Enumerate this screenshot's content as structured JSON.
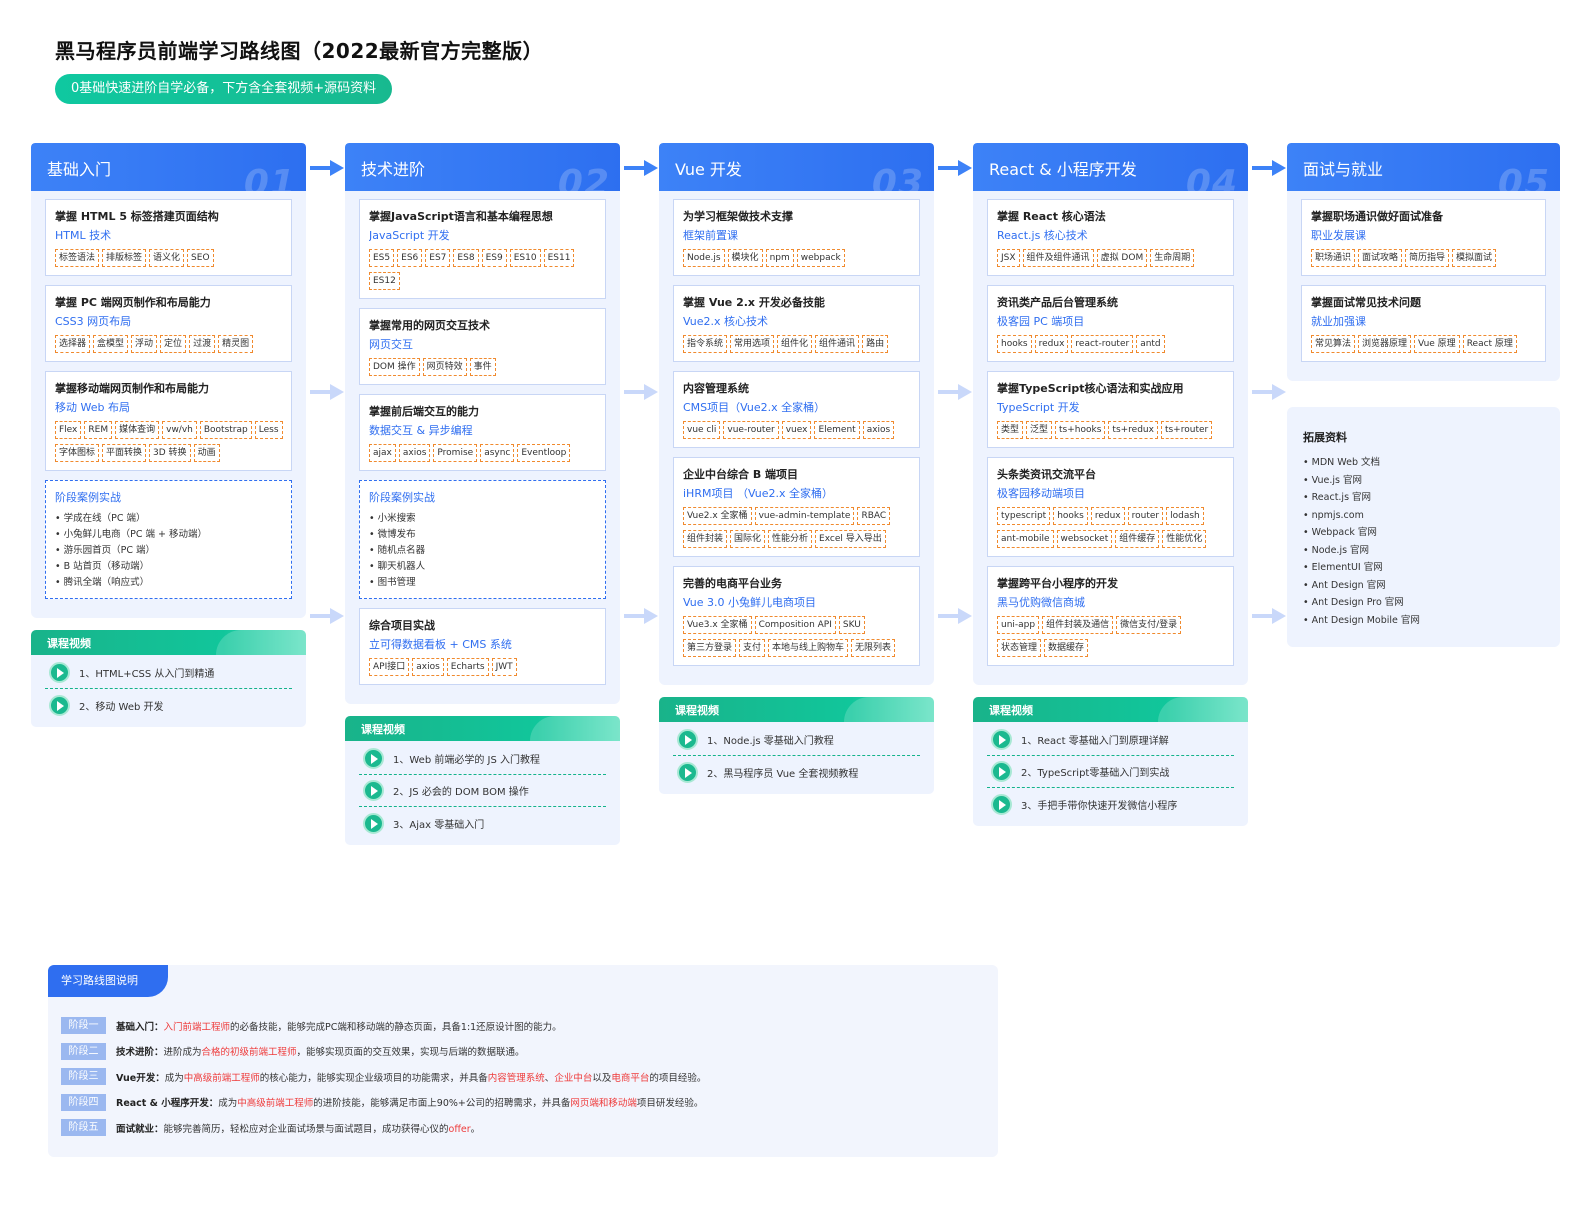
{
  "header": {
    "title": "黑马程序员前端学习路线图（2022最新官方完整版）",
    "subtitle": "0基础快速进阶自学必备，下方含全套视频+源码资料"
  },
  "columns": [
    {
      "label": "基础入门",
      "number": "01",
      "cards": [
        {
          "title": "掌握 HTML 5 标签搭建页面结构",
          "sub": "HTML 技术",
          "tags": [
            "标签语法",
            "排版标签",
            "语义化",
            "SEO"
          ]
        },
        {
          "title": "掌握 PC 端网页制作和布局能力",
          "sub": "CSS3 网页布局",
          "tags": [
            "选择器",
            "盒模型",
            "浮动",
            "定位",
            "过渡",
            "精灵图"
          ]
        },
        {
          "title": "掌握移动端网页制作和布局能力",
          "sub": "移动 Web 布局",
          "tags": [
            "Flex",
            "REM",
            "媒体查询",
            "vw/vh",
            "Bootstrap",
            "Less",
            "字体图标",
            "平面转换",
            "3D 转换",
            "动画"
          ]
        }
      ],
      "case": {
        "title": "阶段案例实战",
        "items": [
          "学成在线（PC 端）",
          "小兔鲜儿电商（PC 端 + 移动端）",
          "游乐园首页（PC 端）",
          "B 站首页（移动端）",
          "腾讯全端（响应式）"
        ]
      },
      "video": {
        "label": "课程视频",
        "items": [
          "1、HTML+CSS 从入门到精通",
          "2、移动 Web 开发"
        ]
      }
    },
    {
      "label": "技术进阶",
      "number": "02",
      "cards": [
        {
          "title": "掌握JavaScript语言和基本编程思想",
          "sub": "JavaScript 开发",
          "tags": [
            "ES5",
            "ES6",
            "ES7",
            "ES8",
            "ES9",
            "ES10",
            "ES11",
            "ES12"
          ]
        },
        {
          "title": "掌握常用的网页交互技术",
          "sub": "网页交互",
          "tags": [
            "DOM 操作",
            "网页特效",
            "事件"
          ]
        },
        {
          "title": "掌握前后端交互的能力",
          "sub": "数据交互 & 异步编程",
          "tags": [
            "ajax",
            "axios",
            "Promise",
            "async",
            "Eventloop"
          ]
        }
      ],
      "case": {
        "title": "阶段案例实战",
        "items": [
          "小米搜索",
          "微博发布",
          "随机点名器",
          "聊天机器人",
          "图书管理"
        ]
      },
      "cards_after": [
        {
          "title": "综合项目实战",
          "sub": "立可得数据看板 + CMS 系统",
          "tags": [
            "API接口",
            "axios",
            "Echarts",
            "JWT"
          ]
        }
      ],
      "video": {
        "label": "课程视频",
        "items": [
          "1、Web 前端必学的 JS 入门教程",
          "2、JS 必会的 DOM BOM 操作",
          "3、Ajax 零基础入门"
        ]
      }
    },
    {
      "label": "Vue 开发",
      "number": "03",
      "cards": [
        {
          "title": "为学习框架做技术支撑",
          "sub": "框架前置课",
          "tags": [
            "Node.js",
            "模块化",
            "npm",
            "webpack"
          ]
        },
        {
          "title": "掌握 Vue 2.x 开发必备技能",
          "sub": "Vue2.x 核心技术",
          "tags": [
            "指令系统",
            "常用选项",
            "组件化",
            "组件通讯",
            "路由"
          ]
        },
        {
          "title": "内容管理系统",
          "sub": "CMS项目（Vue2.x 全家桶）",
          "tags": [
            "vue cli",
            "vue-router",
            "vuex",
            "Element",
            "axios"
          ]
        },
        {
          "title": "企业中台综合 B 端项目",
          "sub": "iHRM项目 （Vue2.x 全家桶）",
          "tags": [
            "Vue2.x 全家桶",
            "vue-admin-template",
            "RBAC",
            "组件封装",
            "国际化",
            "性能分析",
            "Excel 导入导出"
          ]
        },
        {
          "title": "完善的电商平台业务",
          "sub": "Vue 3.0 小兔鲜儿电商项目",
          "tags": [
            "Vue3.x 全家桶",
            "Composition API",
            "SKU",
            "第三方登录",
            "支付",
            "本地与线上购物车",
            "无限列表"
          ]
        }
      ],
      "video": {
        "label": "课程视频",
        "items": [
          "1、Node.js 零基础入门教程",
          "2、黑马程序员 Vue 全套视频教程"
        ]
      }
    },
    {
      "label": "React & 小程序开发",
      "number": "04",
      "cards": [
        {
          "title": "掌握 React 核心语法",
          "sub": "React.js 核心技术",
          "tags": [
            "JSX",
            "组件及组件通讯",
            "虚拟 DOM",
            "生命周期"
          ]
        },
        {
          "title": "资讯类产品后台管理系统",
          "sub": "极客园 PC 端项目",
          "tags": [
            "hooks",
            "redux",
            "react-router",
            "antd"
          ]
        },
        {
          "title": "掌握TypeScript核心语法和实战应用",
          "sub": "TypeScript 开发",
          "tags": [
            "类型",
            "泛型",
            "ts+hooks",
            "ts+redux",
            "ts+router"
          ]
        },
        {
          "title": "头条类资讯交流平台",
          "sub": "极客园移动端项目",
          "tags": [
            "typescript",
            "hooks",
            "redux",
            "router",
            "lodash",
            "ant-mobile",
            "websocket",
            "组件缓存",
            "性能优化"
          ]
        },
        {
          "title": "掌握跨平台小程序的开发",
          "sub": "黑马优购微信商城",
          "tags": [
            "uni-app",
            "组件封装及通信",
            "微信支付/登录",
            "状态管理",
            "数据缓存"
          ]
        }
      ],
      "video": {
        "label": "课程视频",
        "items": [
          "1、React 零基础入门到原理详解",
          "2、TypeScript零基础入门到实战",
          "3、手把手带你快速开发微信小程序"
        ]
      }
    },
    {
      "label": "面试与就业",
      "number": "05",
      "cards": [
        {
          "title": "掌握职场通识做好面试准备",
          "sub": "职业发展课",
          "tags": [
            "职场通识",
            "面试攻略",
            "简历指导",
            "模拟面试"
          ]
        },
        {
          "title": "掌握面试常见技术问题",
          "sub": "就业加强课",
          "tags": [
            "常见算法",
            "浏览器原理",
            "Vue 原理",
            "React 原理"
          ]
        }
      ]
    }
  ],
  "resources": {
    "title": "拓展资料",
    "items": [
      "MDN Web 文档",
      "Vue.js 官网",
      "React.js 官网",
      "npmjs.com",
      "Webpack 官网",
      "Node.js 官网",
      "ElementUI 官网",
      "Ant Design 官网",
      "Ant Design Pro 官网",
      "Ant Design Mobile 官网"
    ]
  },
  "legend": {
    "title": "学习路线图说明",
    "rows": [
      {
        "badge": "阶段一",
        "name": "基础入门：",
        "parts": [
          [
            "入门前端工程师",
            true
          ],
          [
            "的必备技能，能够完成PC端和移动端的静态页面，具备1:1还原设计图的能力。",
            false
          ]
        ]
      },
      {
        "badge": "阶段二",
        "name": "技术进阶：",
        "parts": [
          [
            "进阶成为",
            false
          ],
          [
            "合格的初级前端工程师",
            true
          ],
          [
            "，能够实现页面的交互效果，实现与后端的数据联通。",
            false
          ]
        ]
      },
      {
        "badge": "阶段三",
        "name": "Vue开发：",
        "parts": [
          [
            "成为",
            false
          ],
          [
            "中高级前端工程师",
            true
          ],
          [
            "的核心能力，能够实现企业级项目的功能需求，并具备",
            false
          ],
          [
            "内容管理系统",
            true
          ],
          [
            "、",
            false
          ],
          [
            "企业中台",
            true
          ],
          [
            "以及",
            false
          ],
          [
            "电商平台",
            true
          ],
          [
            "的项目经验。",
            false
          ]
        ]
      },
      {
        "badge": "阶段四",
        "name": "React & 小程序开发：",
        "parts": [
          [
            "成为",
            false
          ],
          [
            "中高级前端工程师",
            true
          ],
          [
            "的进阶技能，能够满足市面上90%+公司的招聘需求，并具备",
            false
          ],
          [
            "网页端和移动端",
            true
          ],
          [
            "项目研发经验。",
            false
          ]
        ]
      },
      {
        "badge": "阶段五",
        "name": "面试就业：",
        "parts": [
          [
            "能够完善简历，轻松应对企业面试场景与面试题目，成功获得心仪的",
            false
          ],
          [
            "offer",
            true
          ],
          [
            "。",
            false
          ]
        ]
      }
    ]
  },
  "colors": {
    "primary": "#2f6ef0",
    "accent_green": "#19b38a",
    "tag_border": "#f08a2e",
    "highlight": "#ee3b3b",
    "panel_bg": "#eef3fe"
  }
}
